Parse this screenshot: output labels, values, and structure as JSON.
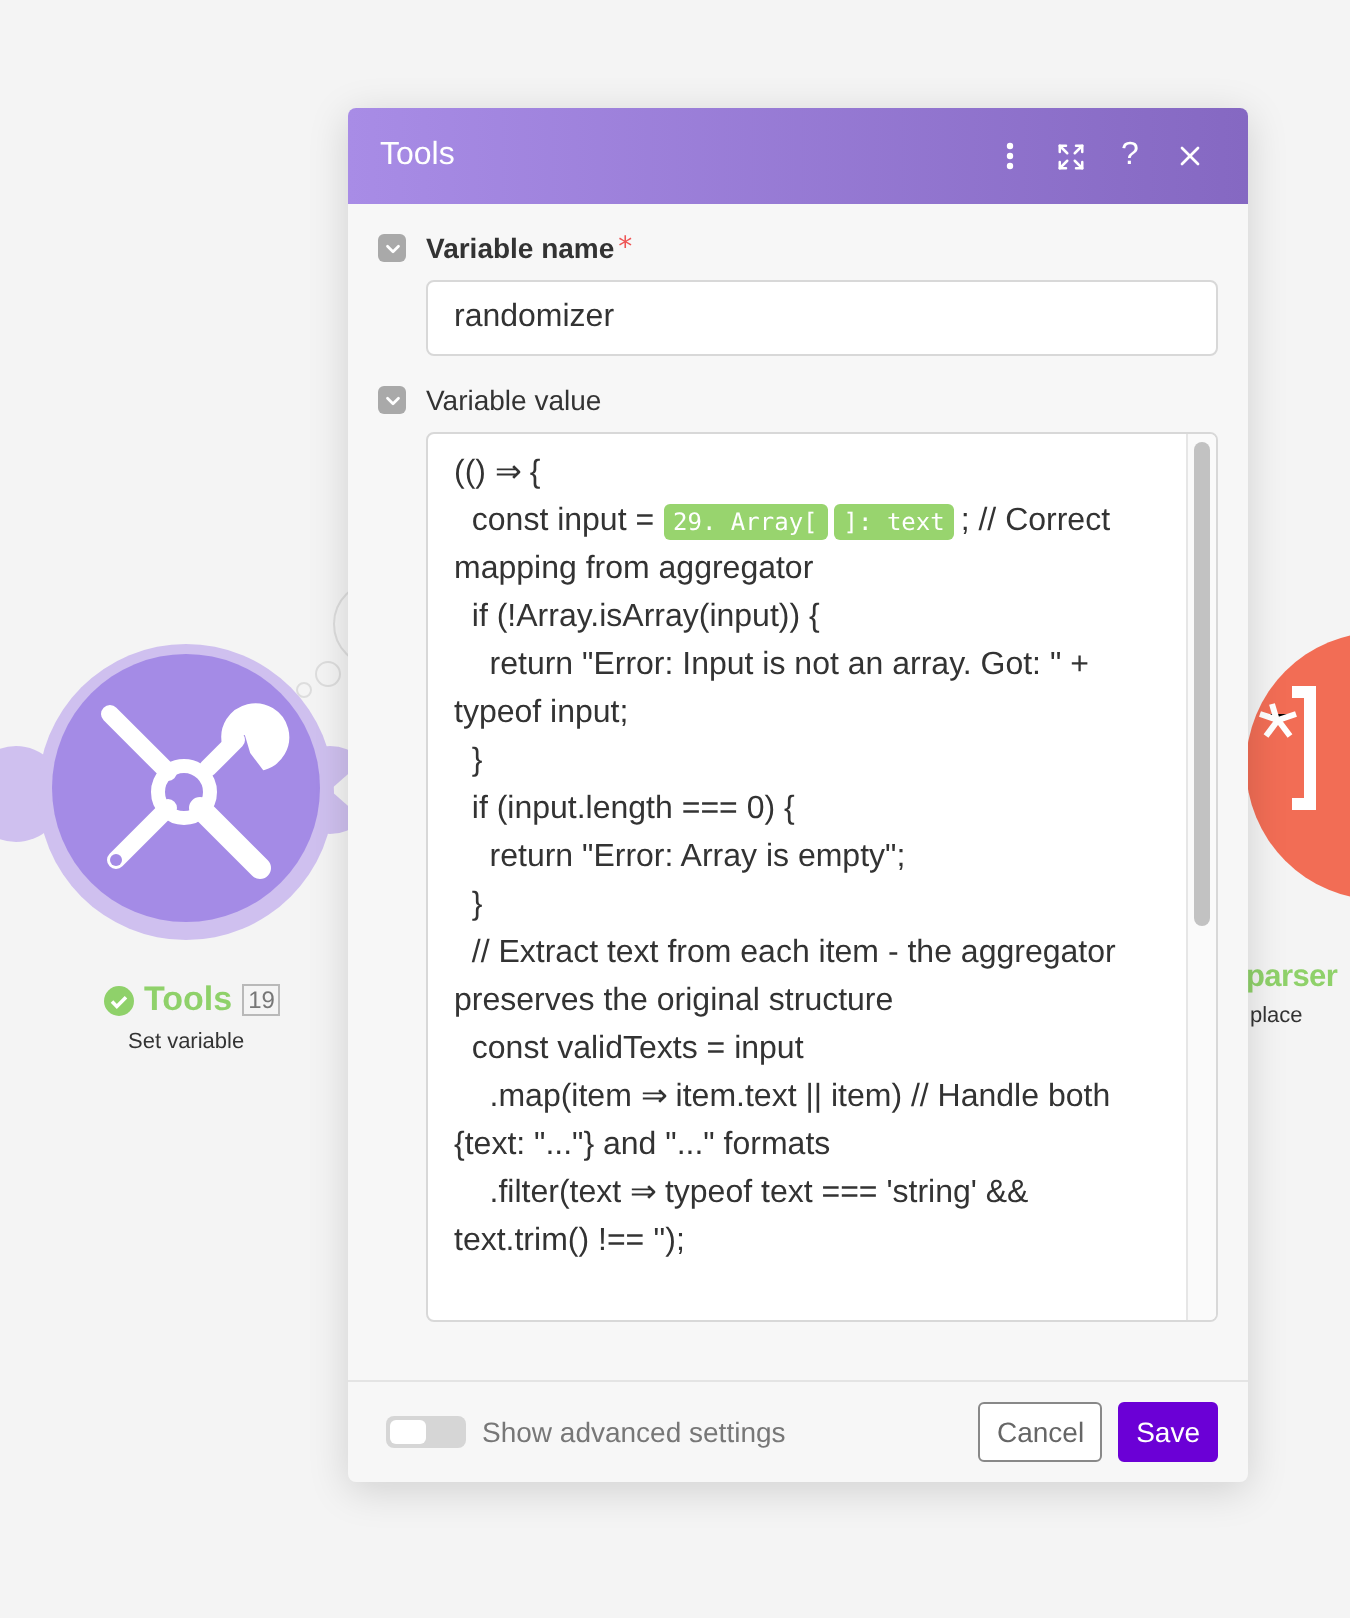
{
  "canvas": {
    "nodes": [
      {
        "kind": "tools",
        "title": "Tools",
        "badge": "19",
        "subtitle": "Set variable"
      },
      {
        "kind": "parser",
        "title": "parser",
        "subtitle": "place"
      }
    ]
  },
  "dialog": {
    "title": "Tools",
    "header_actions": [
      {
        "kind": "more"
      },
      {
        "kind": "expand"
      },
      {
        "kind": "help",
        "text": "?"
      },
      {
        "kind": "close"
      }
    ],
    "fields": [
      {
        "label": "Variable name",
        "required": true,
        "required_mark": "*",
        "expanded": true,
        "kind": "input",
        "value": "randomizer"
      },
      {
        "label": "Variable value",
        "required": false,
        "expanded": true,
        "kind": "code",
        "lines": [
          {
            "parts": [
              {
                "kind": "text",
                "text": "(() ⇒ {"
              }
            ]
          },
          {
            "parts": [
              {
                "kind": "text",
                "text": "  const input = "
              },
              {
                "kind": "token",
                "text": "29. Array["
              },
              {
                "kind": "token",
                "text": "]: text"
              },
              {
                "kind": "text",
                "text": "; // Correct"
              },
              {
                "kind": "break",
                "text": "mapping from aggregator"
              }
            ]
          },
          {
            "parts": [
              {
                "kind": "text",
                "text": "  if (!Array.isArray(input)) {"
              }
            ]
          },
          {
            "parts": [
              {
                "kind": "text",
                "text": "    return \"Error: Input is not an array. Got: \" + typeof input;"
              }
            ]
          },
          {
            "parts": [
              {
                "kind": "text",
                "text": "  }"
              }
            ]
          },
          {
            "parts": [
              {
                "kind": "text",
                "text": "  if (input.length === 0) {"
              }
            ]
          },
          {
            "parts": [
              {
                "kind": "text",
                "text": "    return \"Error: Array is empty\";"
              }
            ]
          },
          {
            "parts": [
              {
                "kind": "text",
                "text": "  }"
              }
            ]
          },
          {
            "parts": [
              {
                "kind": "text",
                "text": "  // Extract text from each item - the aggregator preserves the original structure"
              }
            ]
          },
          {
            "parts": [
              {
                "kind": "text",
                "text": "  const validTexts = input"
              }
            ]
          },
          {
            "parts": [
              {
                "kind": "text",
                "text": "    .map(item ⇒ item.text || item) // Handle both {text: \"...\"} and \"...\" formats"
              }
            ]
          },
          {
            "parts": [
              {
                "kind": "text",
                "text": "    .filter(text ⇒ typeof text === 'string' && text.trim() !== '');"
              }
            ]
          }
        ]
      }
    ],
    "advanced": {
      "label": "Show advanced settings",
      "on": false
    },
    "buttons": [
      {
        "kind": "secondary",
        "label": "Cancel"
      },
      {
        "kind": "primary",
        "label": "Save"
      }
    ]
  }
}
